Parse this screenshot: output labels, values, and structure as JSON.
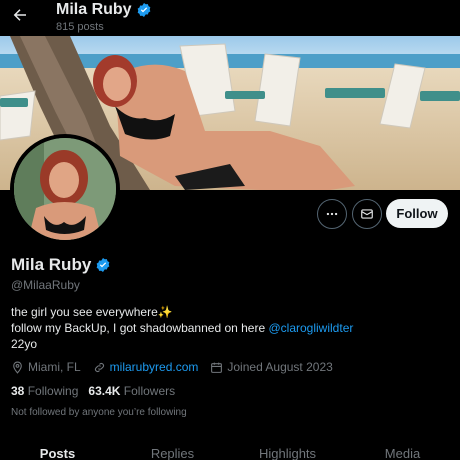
{
  "topbar": {
    "name": "Mila Ruby",
    "posts": "815 posts"
  },
  "profile": {
    "name": "Mila Ruby",
    "handle": "@MilaaRuby",
    "bio_line1": "the girl you see everywhere✨",
    "bio_line2_prefix": "follow my BackUp, I got shadowbanned on here ",
    "bio_line2_link": "@clarogliwildter",
    "bio_line3": "22yo",
    "location": "Miami, FL",
    "website": "milarubyred.com",
    "joined": "Joined August 2023",
    "following_count": "38",
    "following_label": "Following",
    "followers_count": "63.4K",
    "followers_label": "Followers",
    "not_followed": "Not followed by anyone you’re following"
  },
  "actions": {
    "more_icon": "more-icon",
    "message_icon": "message-icon",
    "follow_label": "Follow"
  },
  "tabs": [
    {
      "label": "Posts"
    },
    {
      "label": "Replies"
    },
    {
      "label": "Highlights"
    },
    {
      "label": "Media"
    }
  ],
  "colors": {
    "accent": "#1d9bf0",
    "background": "#000000",
    "text": "#e7e9ea",
    "muted": "#71767b"
  }
}
